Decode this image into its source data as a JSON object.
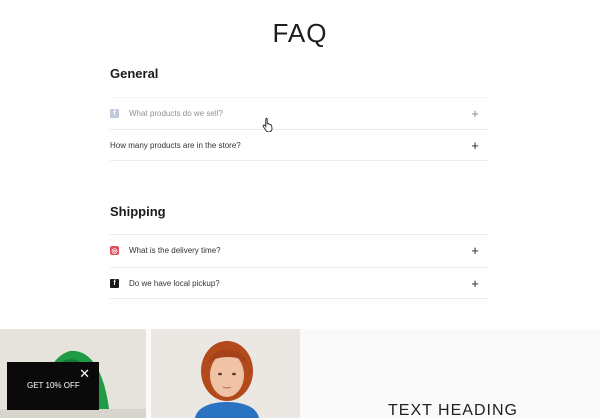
{
  "page": {
    "title": "FAQ"
  },
  "sections": [
    {
      "title": "General",
      "items": [
        {
          "icon": "facebook-icon",
          "question": "What products do we sell?"
        },
        {
          "icon": "",
          "question": "How many products are in the store?"
        }
      ]
    },
    {
      "title": "Shipping",
      "items": [
        {
          "icon": "instagram-icon",
          "question": "What is the delivery time?"
        },
        {
          "icon": "facebook-icon",
          "question": "Do we have local pickup?"
        }
      ]
    }
  ],
  "promo": {
    "label": "GET 10% OFF",
    "close": "✕"
  },
  "banner": {
    "heading": "TEXT HEADING"
  },
  "colors": {
    "promo_bg": "#0a0a0a",
    "instagram": "#e0505a",
    "facebook": "#8ea0c0"
  }
}
